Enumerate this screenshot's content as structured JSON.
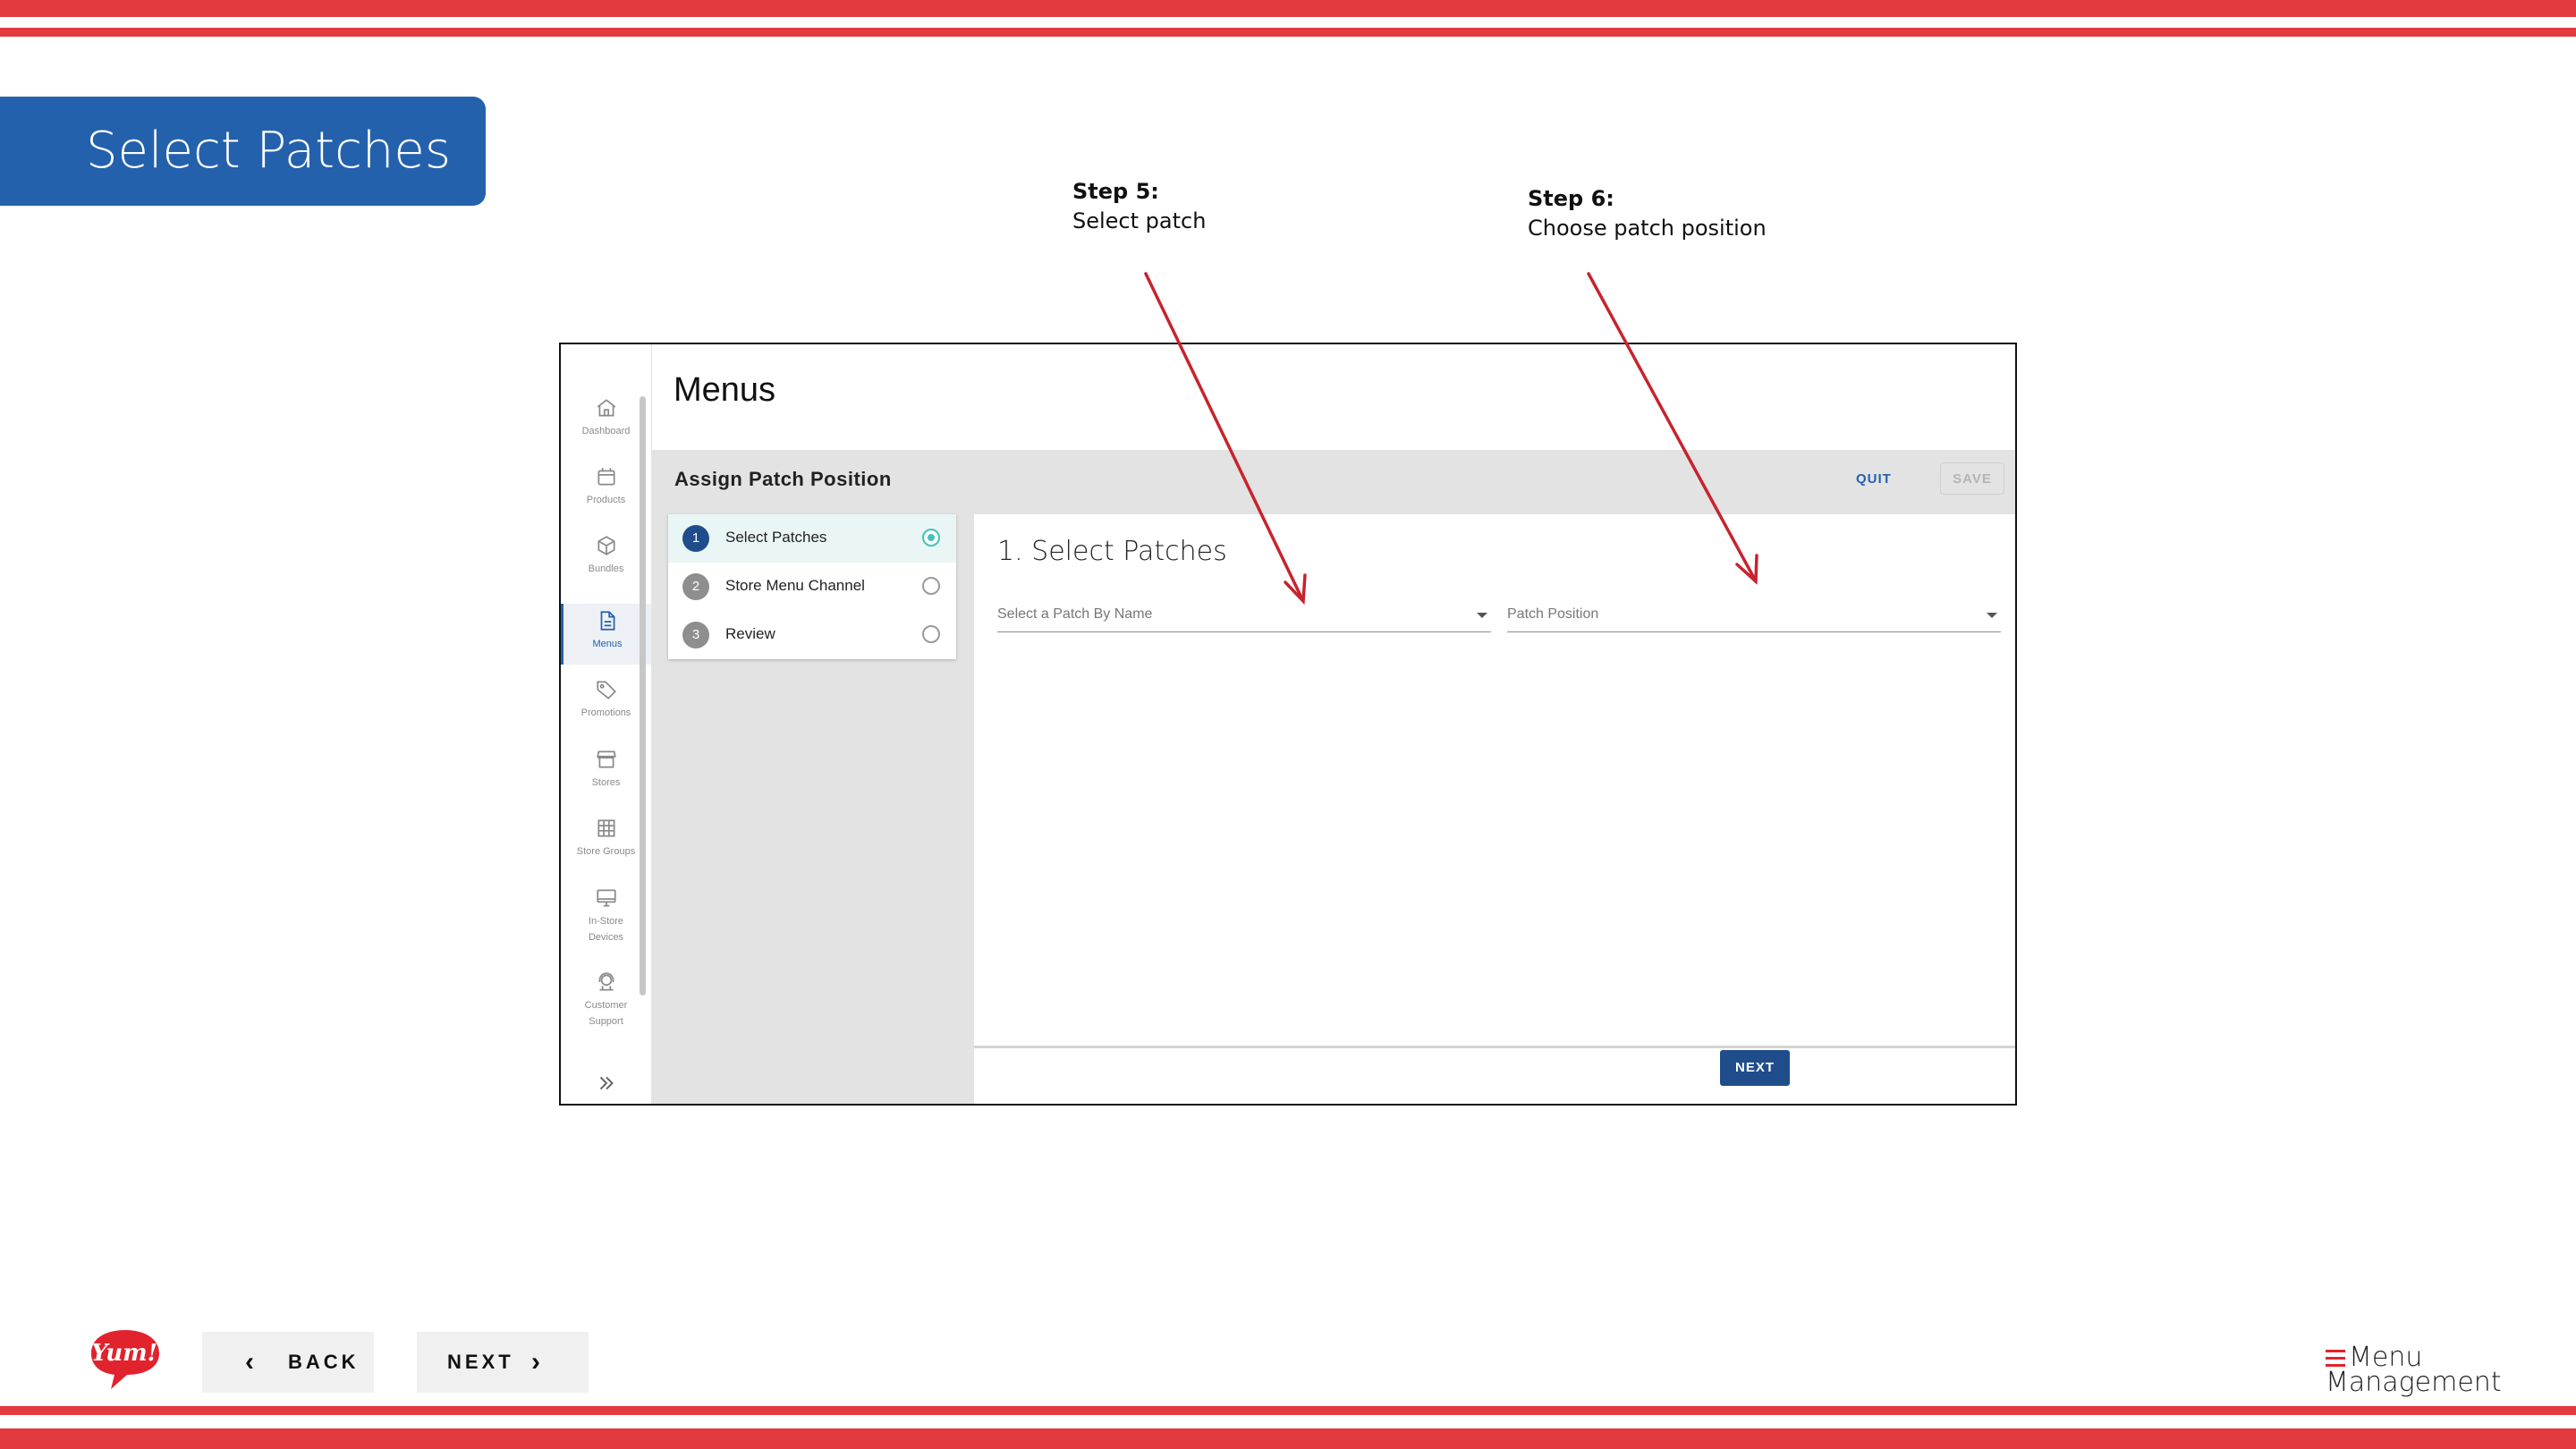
{
  "slide": {
    "title": "Select Patches",
    "accent_color": "#e23a3f",
    "banner_color": "#2461ad"
  },
  "annotations": [
    {
      "heading": "Step 5:",
      "text": "Select patch"
    },
    {
      "heading": "Step 6:",
      "text": "Choose patch position"
    }
  ],
  "app": {
    "page_title": "Menus",
    "sidebar": [
      {
        "label": "Dashboard",
        "icon": "home-icon"
      },
      {
        "label": "Products",
        "icon": "box-icon"
      },
      {
        "label": "Bundles",
        "icon": "cube-icon"
      },
      {
        "label": "Menus",
        "icon": "document-icon",
        "active": true
      },
      {
        "label": "Promotions",
        "icon": "tag-icon"
      },
      {
        "label": "Stores",
        "icon": "storefront-icon"
      },
      {
        "label": "Store Groups",
        "icon": "grid-icon"
      },
      {
        "label": "In-Store\nDevices",
        "icon": "monitor-icon"
      },
      {
        "label": "Customer\nSupport",
        "icon": "headset-icon"
      }
    ],
    "toolbar": {
      "title": "Assign Patch Position",
      "quit_label": "QUIT",
      "save_label": "SAVE"
    },
    "steps": [
      {
        "number": "1",
        "label": "Select Patches",
        "active": true
      },
      {
        "number": "2",
        "label": "Store Menu Channel"
      },
      {
        "number": "3",
        "label": "Review"
      }
    ],
    "content": {
      "heading": "1. Select Patches",
      "patch_select_placeholder": "Select a Patch By Name",
      "position_select_placeholder": "Patch Position"
    },
    "footer": {
      "next_label": "NEXT"
    }
  },
  "navigation": {
    "back_label": "BACK",
    "next_label": "NEXT"
  },
  "branding": {
    "logo_text": "Yum!",
    "product_name_line1": "Menu",
    "product_name_line2": "Management"
  }
}
